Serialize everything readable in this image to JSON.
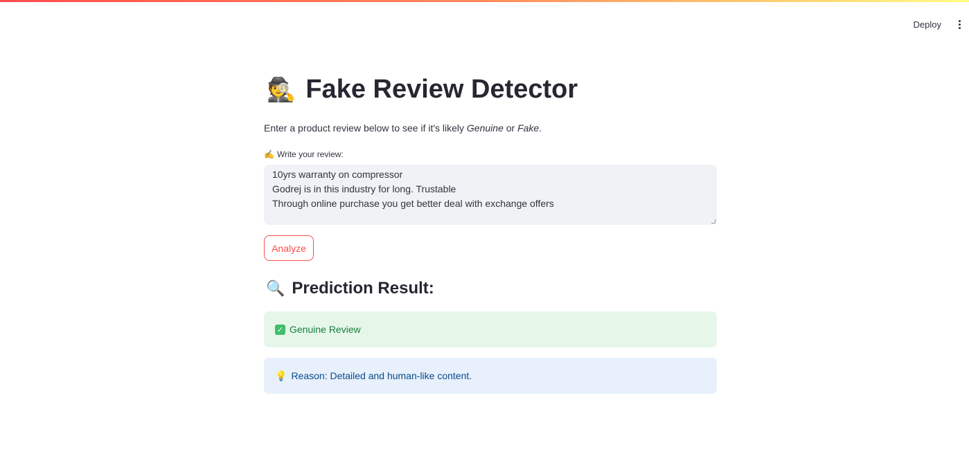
{
  "header": {
    "deploy_label": "Deploy"
  },
  "main": {
    "title": "Fake Review Detector",
    "title_icon": "🕵️",
    "subtitle_prefix": "Enter a product review below to see if it's likely ",
    "subtitle_genuine": "Genuine",
    "subtitle_or": " or ",
    "subtitle_fake": "Fake",
    "subtitle_suffix": ".",
    "input_label": "Write your review:",
    "input_label_icon": "✍️",
    "review_lines": [
      "10yrs warranty on compressor",
      "Godrej is in this industry for long. Trustable",
      "Through online purchase you get better deal with exchange offers"
    ],
    "analyze_label": "Analyze",
    "result_heading": "Prediction Result:",
    "result_icon": "🔍",
    "result_label": "Genuine Review",
    "reason_text": "Reason: Detailed and human-like content."
  },
  "colors": {
    "accent": "#ff4b4b",
    "success_bg": "#e6f7ea",
    "info_bg": "#e7f0fb"
  }
}
